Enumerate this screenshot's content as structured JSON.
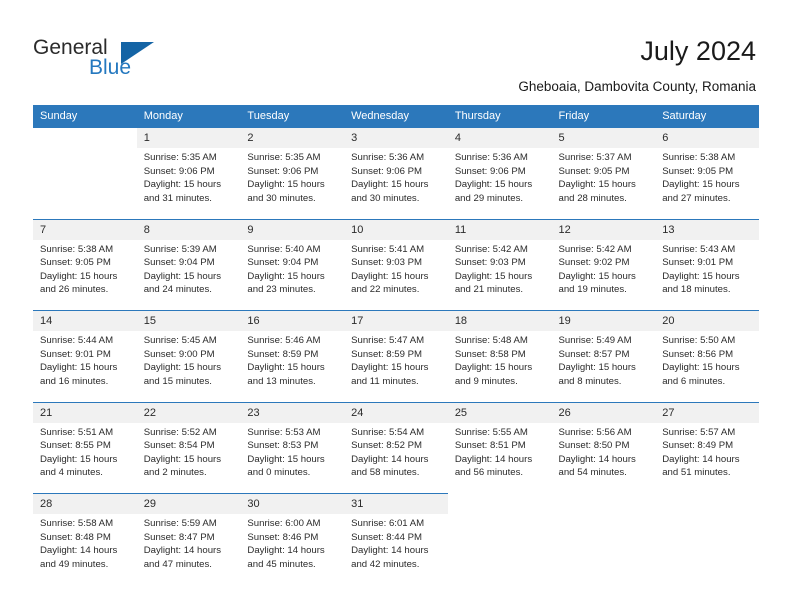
{
  "brand": {
    "name_part1": "General",
    "name_part2": "Blue",
    "accent_color": "#1464a5",
    "blue_text_color": "#2478bf"
  },
  "header": {
    "title": "July 2024",
    "location": "Gheboaia, Dambovita County, Romania"
  },
  "theme": {
    "header_bg": "#2c78bb",
    "daynum_bg": "#f1f1f1",
    "text": "#2b2b2b"
  },
  "calendar": {
    "weekday_headers": [
      "Sunday",
      "Monday",
      "Tuesday",
      "Wednesday",
      "Thursday",
      "Friday",
      "Saturday"
    ],
    "labels": {
      "sunrise_prefix": "Sunrise: ",
      "sunset_prefix": "Sunset: ",
      "daylight_prefix": "Daylight: "
    },
    "weeks": [
      [
        {
          "day": "",
          "sunrise": "",
          "sunset": "",
          "daylight": ""
        },
        {
          "day": "1",
          "sunrise": "Sunrise: 5:35 AM",
          "sunset": "Sunset: 9:06 PM",
          "daylight": "Daylight: 15 hours and 31 minutes."
        },
        {
          "day": "2",
          "sunrise": "Sunrise: 5:35 AM",
          "sunset": "Sunset: 9:06 PM",
          "daylight": "Daylight: 15 hours and 30 minutes."
        },
        {
          "day": "3",
          "sunrise": "Sunrise: 5:36 AM",
          "sunset": "Sunset: 9:06 PM",
          "daylight": "Daylight: 15 hours and 30 minutes."
        },
        {
          "day": "4",
          "sunrise": "Sunrise: 5:36 AM",
          "sunset": "Sunset: 9:06 PM",
          "daylight": "Daylight: 15 hours and 29 minutes."
        },
        {
          "day": "5",
          "sunrise": "Sunrise: 5:37 AM",
          "sunset": "Sunset: 9:05 PM",
          "daylight": "Daylight: 15 hours and 28 minutes."
        },
        {
          "day": "6",
          "sunrise": "Sunrise: 5:38 AM",
          "sunset": "Sunset: 9:05 PM",
          "daylight": "Daylight: 15 hours and 27 minutes."
        }
      ],
      [
        {
          "day": "7",
          "sunrise": "Sunrise: 5:38 AM",
          "sunset": "Sunset: 9:05 PM",
          "daylight": "Daylight: 15 hours and 26 minutes."
        },
        {
          "day": "8",
          "sunrise": "Sunrise: 5:39 AM",
          "sunset": "Sunset: 9:04 PM",
          "daylight": "Daylight: 15 hours and 24 minutes."
        },
        {
          "day": "9",
          "sunrise": "Sunrise: 5:40 AM",
          "sunset": "Sunset: 9:04 PM",
          "daylight": "Daylight: 15 hours and 23 minutes."
        },
        {
          "day": "10",
          "sunrise": "Sunrise: 5:41 AM",
          "sunset": "Sunset: 9:03 PM",
          "daylight": "Daylight: 15 hours and 22 minutes."
        },
        {
          "day": "11",
          "sunrise": "Sunrise: 5:42 AM",
          "sunset": "Sunset: 9:03 PM",
          "daylight": "Daylight: 15 hours and 21 minutes."
        },
        {
          "day": "12",
          "sunrise": "Sunrise: 5:42 AM",
          "sunset": "Sunset: 9:02 PM",
          "daylight": "Daylight: 15 hours and 19 minutes."
        },
        {
          "day": "13",
          "sunrise": "Sunrise: 5:43 AM",
          "sunset": "Sunset: 9:01 PM",
          "daylight": "Daylight: 15 hours and 18 minutes."
        }
      ],
      [
        {
          "day": "14",
          "sunrise": "Sunrise: 5:44 AM",
          "sunset": "Sunset: 9:01 PM",
          "daylight": "Daylight: 15 hours and 16 minutes."
        },
        {
          "day": "15",
          "sunrise": "Sunrise: 5:45 AM",
          "sunset": "Sunset: 9:00 PM",
          "daylight": "Daylight: 15 hours and 15 minutes."
        },
        {
          "day": "16",
          "sunrise": "Sunrise: 5:46 AM",
          "sunset": "Sunset: 8:59 PM",
          "daylight": "Daylight: 15 hours and 13 minutes."
        },
        {
          "day": "17",
          "sunrise": "Sunrise: 5:47 AM",
          "sunset": "Sunset: 8:59 PM",
          "daylight": "Daylight: 15 hours and 11 minutes."
        },
        {
          "day": "18",
          "sunrise": "Sunrise: 5:48 AM",
          "sunset": "Sunset: 8:58 PM",
          "daylight": "Daylight: 15 hours and 9 minutes."
        },
        {
          "day": "19",
          "sunrise": "Sunrise: 5:49 AM",
          "sunset": "Sunset: 8:57 PM",
          "daylight": "Daylight: 15 hours and 8 minutes."
        },
        {
          "day": "20",
          "sunrise": "Sunrise: 5:50 AM",
          "sunset": "Sunset: 8:56 PM",
          "daylight": "Daylight: 15 hours and 6 minutes."
        }
      ],
      [
        {
          "day": "21",
          "sunrise": "Sunrise: 5:51 AM",
          "sunset": "Sunset: 8:55 PM",
          "daylight": "Daylight: 15 hours and 4 minutes."
        },
        {
          "day": "22",
          "sunrise": "Sunrise: 5:52 AM",
          "sunset": "Sunset: 8:54 PM",
          "daylight": "Daylight: 15 hours and 2 minutes."
        },
        {
          "day": "23",
          "sunrise": "Sunrise: 5:53 AM",
          "sunset": "Sunset: 8:53 PM",
          "daylight": "Daylight: 15 hours and 0 minutes."
        },
        {
          "day": "24",
          "sunrise": "Sunrise: 5:54 AM",
          "sunset": "Sunset: 8:52 PM",
          "daylight": "Daylight: 14 hours and 58 minutes."
        },
        {
          "day": "25",
          "sunrise": "Sunrise: 5:55 AM",
          "sunset": "Sunset: 8:51 PM",
          "daylight": "Daylight: 14 hours and 56 minutes."
        },
        {
          "day": "26",
          "sunrise": "Sunrise: 5:56 AM",
          "sunset": "Sunset: 8:50 PM",
          "daylight": "Daylight: 14 hours and 54 minutes."
        },
        {
          "day": "27",
          "sunrise": "Sunrise: 5:57 AM",
          "sunset": "Sunset: 8:49 PM",
          "daylight": "Daylight: 14 hours and 51 minutes."
        }
      ],
      [
        {
          "day": "28",
          "sunrise": "Sunrise: 5:58 AM",
          "sunset": "Sunset: 8:48 PM",
          "daylight": "Daylight: 14 hours and 49 minutes."
        },
        {
          "day": "29",
          "sunrise": "Sunrise: 5:59 AM",
          "sunset": "Sunset: 8:47 PM",
          "daylight": "Daylight: 14 hours and 47 minutes."
        },
        {
          "day": "30",
          "sunrise": "Sunrise: 6:00 AM",
          "sunset": "Sunset: 8:46 PM",
          "daylight": "Daylight: 14 hours and 45 minutes."
        },
        {
          "day": "31",
          "sunrise": "Sunrise: 6:01 AM",
          "sunset": "Sunset: 8:44 PM",
          "daylight": "Daylight: 14 hours and 42 minutes."
        },
        {
          "day": "",
          "sunrise": "",
          "sunset": "",
          "daylight": ""
        },
        {
          "day": "",
          "sunrise": "",
          "sunset": "",
          "daylight": ""
        },
        {
          "day": "",
          "sunrise": "",
          "sunset": "",
          "daylight": ""
        }
      ]
    ]
  }
}
